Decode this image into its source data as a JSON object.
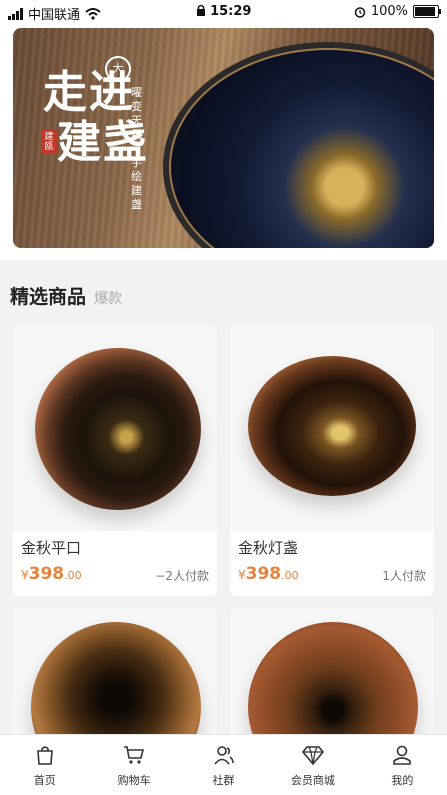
{
  "status": {
    "carrier": "中国联通",
    "time": "15:29",
    "battery": "100%"
  },
  "banner": {
    "title_line1": "走进",
    "title_line2": "建盏",
    "vertical_text": "曜变天目·手绘建盏",
    "seal_text": "建瓯",
    "logo_char": "大"
  },
  "section": {
    "title": "精选商品",
    "subtitle": "爆款"
  },
  "products": [
    {
      "name": "金秋平口",
      "currency": "¥",
      "price": "398",
      "decimal": ".00",
      "payers": "−2人付款"
    },
    {
      "name": "金秋灯盏",
      "currency": "¥",
      "price": "398",
      "decimal": ".00",
      "payers": "1人付款"
    },
    {
      "name": "",
      "currency": "",
      "price": "",
      "decimal": "",
      "payers": ""
    },
    {
      "name": "",
      "currency": "",
      "price": "",
      "decimal": "",
      "payers": ""
    }
  ],
  "tabs": [
    {
      "label": "首页",
      "icon": "bag-icon"
    },
    {
      "label": "购物车",
      "icon": "cart-icon"
    },
    {
      "label": "社群",
      "icon": "community-icon"
    },
    {
      "label": "会员商城",
      "icon": "diamond-icon"
    },
    {
      "label": "我的",
      "icon": "user-icon"
    }
  ]
}
